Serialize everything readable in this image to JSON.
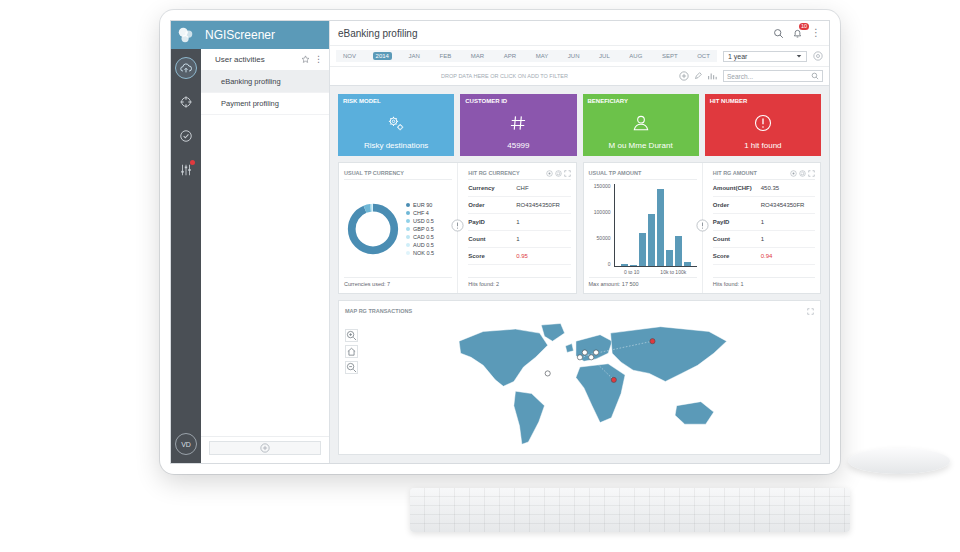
{
  "app": {
    "logo": "NGIScreener",
    "avatar": "VD"
  },
  "nav": [
    {
      "kind": "activity",
      "selected": true,
      "alert": false
    },
    {
      "kind": "target",
      "selected": false,
      "alert": false
    },
    {
      "kind": "shield",
      "selected": false,
      "alert": false
    },
    {
      "kind": "settings",
      "selected": false,
      "alert": true
    }
  ],
  "sidebar": {
    "section": "User activities",
    "menu_glyph": "⋮",
    "items": [
      {
        "label": "eBanking profiling",
        "selected": true
      },
      {
        "label": "Payment profiling",
        "selected": false
      }
    ]
  },
  "header": {
    "title": "eBanking profiling",
    "notifications": "10",
    "menu_glyph": "⋮"
  },
  "timeline": {
    "months": [
      {
        "label": "NOV",
        "selected": false
      },
      {
        "label": "2014",
        "selected": true
      },
      {
        "label": "JAN",
        "selected": false
      },
      {
        "label": "FEB",
        "selected": false
      },
      {
        "label": "MAR",
        "selected": false
      },
      {
        "label": "APR",
        "selected": false
      },
      {
        "label": "MAY",
        "selected": false
      },
      {
        "label": "JUN",
        "selected": false
      },
      {
        "label": "JUL",
        "selected": false
      },
      {
        "label": "AUG",
        "selected": false
      },
      {
        "label": "SEPT",
        "selected": false
      },
      {
        "label": "OCT",
        "selected": false
      }
    ],
    "period": "1 year"
  },
  "toolbar": {
    "hint": "DROP DATA HERE OR CLICK ON ADD TO FILTER",
    "search_placeholder": "Search..."
  },
  "cards": [
    {
      "title": "RISK MODEL",
      "value": "Risky destinations",
      "color": "#5aafdc",
      "kind": "gears"
    },
    {
      "title": "CUSTOMER ID",
      "value": "45999",
      "color": "#8b56ad",
      "kind": "hash"
    },
    {
      "title": "BENEFICIARY",
      "value": "M ou Mme Durant",
      "color": "#6cc24a",
      "kind": "person"
    },
    {
      "title": "HIT NUMBER",
      "value": "1 hit found",
      "color": "#e0393e",
      "kind": "alert"
    }
  ],
  "currency_panel": {
    "title": "USUAL TP CURRENCY",
    "legend": [
      {
        "label": "EUR 90",
        "value": 90,
        "color": "#4a8db3"
      },
      {
        "label": "CHF 4",
        "value": 4,
        "color": "#6fb7d6"
      },
      {
        "label": "USD 0.5",
        "value": 0.5,
        "color": "#8fd0e8"
      },
      {
        "label": "GBP 0.5",
        "value": 0.5,
        "color": "#a6dcee"
      },
      {
        "label": "CAD 0.5",
        "value": 0.5,
        "color": "#bde6f3"
      },
      {
        "label": "AUD 0.5",
        "value": 0.5,
        "color": "#cfeef8"
      },
      {
        "label": "NOK 0.5",
        "value": 0.5,
        "color": "#dff4fb"
      }
    ],
    "footer": "Currencies used: 7"
  },
  "hit_currency": {
    "title": "HIT RG CURRENCY",
    "rows": [
      {
        "label": "Currency",
        "value": "CHF",
        "alert": false
      },
      {
        "label": "Order",
        "value": "RO43454350FR",
        "alert": false
      },
      {
        "label": "PayID",
        "value": "1",
        "alert": false
      },
      {
        "label": "Count",
        "value": "1",
        "alert": false
      },
      {
        "label": "Score",
        "value": "0.95",
        "alert": true
      }
    ],
    "footer": "Hits found: 2"
  },
  "amount_chart": {
    "title": "USUAL TP AMOUNT",
    "y_ticks": [
      "150000",
      "100000",
      "50000",
      "0"
    ],
    "y_max": 150000,
    "x_labels": [
      "0 to 10",
      "10k to 100k"
    ],
    "values": [
      3000,
      1500,
      60000,
      95000,
      140000,
      30000,
      55000,
      8000
    ],
    "footer": "Max amount: 17 500"
  },
  "hit_amount": {
    "title": "HIT RG AMOUNT",
    "rows": [
      {
        "label": "Amount(CHF)",
        "value": "450.35",
        "alert": false
      },
      {
        "label": "Order",
        "value": "RO43454350FR",
        "alert": false
      },
      {
        "label": "PayID",
        "value": "1",
        "alert": false
      },
      {
        "label": "Count",
        "value": "1",
        "alert": false
      },
      {
        "label": "Score",
        "value": "0.94",
        "alert": true
      }
    ],
    "footer": "Hits found: 1"
  },
  "map": {
    "title": "MAP RG TRANSACTIONS"
  }
}
